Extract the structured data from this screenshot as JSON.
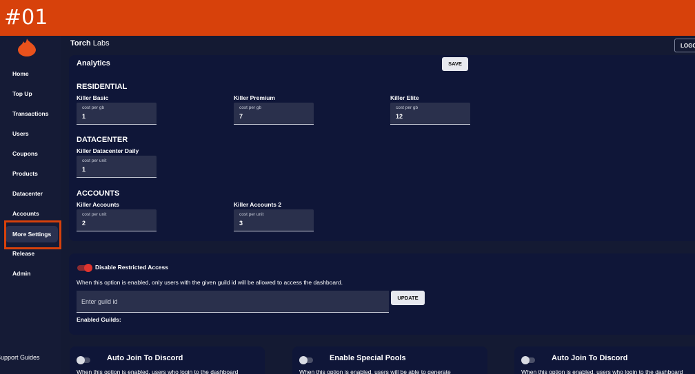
{
  "step": {
    "label": "#01"
  },
  "brand": {
    "bold": "Torch",
    "rest": " Labs"
  },
  "header": {
    "logout_label": "LOGOUT"
  },
  "sidebar": {
    "items": [
      {
        "label": "Home"
      },
      {
        "label": "Top Up"
      },
      {
        "label": "Transactions"
      },
      {
        "label": "Users"
      },
      {
        "label": "Coupons"
      },
      {
        "label": "Products"
      },
      {
        "label": "Datacenter"
      },
      {
        "label": "Accounts"
      },
      {
        "label": "More Settings",
        "active": true
      },
      {
        "label": "Release"
      },
      {
        "label": "Admin"
      }
    ],
    "support_label": "Support Guides"
  },
  "analytics": {
    "title": "Analytics",
    "save_label": "SAVE",
    "residential": {
      "title": "RESIDENTIAL",
      "products": [
        {
          "name": "Killer Basic",
          "field_label": "cost per gb",
          "value": "1"
        },
        {
          "name": "Killer Premium",
          "field_label": "cost per gb",
          "value": "7"
        },
        {
          "name": "Killer Elite",
          "field_label": "cost per gb",
          "value": "12"
        }
      ]
    },
    "datacenter": {
      "title": "DATACENTER",
      "products": [
        {
          "name": "Killer Datacenter Daily",
          "field_label": "cost per unit",
          "value": "1"
        }
      ]
    },
    "accounts": {
      "title": "ACCOUNTS",
      "products": [
        {
          "name": "Killer Accounts",
          "field_label": "cost per unit",
          "value": "2"
        },
        {
          "name": "Killer Accounts 2",
          "field_label": "cost per unit",
          "value": "3"
        }
      ]
    }
  },
  "restricted": {
    "label": "Disable Restricted Access",
    "enabled": true,
    "description": "When this option is enabled, only users with the given guild id will be allowed to access the dashboard.",
    "guild_placeholder": "Enter guild id",
    "update_label": "UPDATE",
    "enabled_guilds_label": "Enabled Guilds:"
  },
  "options": [
    {
      "title": "Auto Join To Discord",
      "enabled": false,
      "description": "When this option is enabled, users who login to the dashboard"
    },
    {
      "title": "Enable Special Pools",
      "enabled": false,
      "description": "When this option is enabled, users will be able to generate"
    },
    {
      "title": "Auto Join To Discord",
      "enabled": false,
      "description": "When this option is enabled, users who login to the dashboard"
    }
  ],
  "colors": {
    "accent": "#d7410b",
    "background": "#141a33",
    "card": "#0f1638",
    "toggle_on": "#e0342e"
  }
}
